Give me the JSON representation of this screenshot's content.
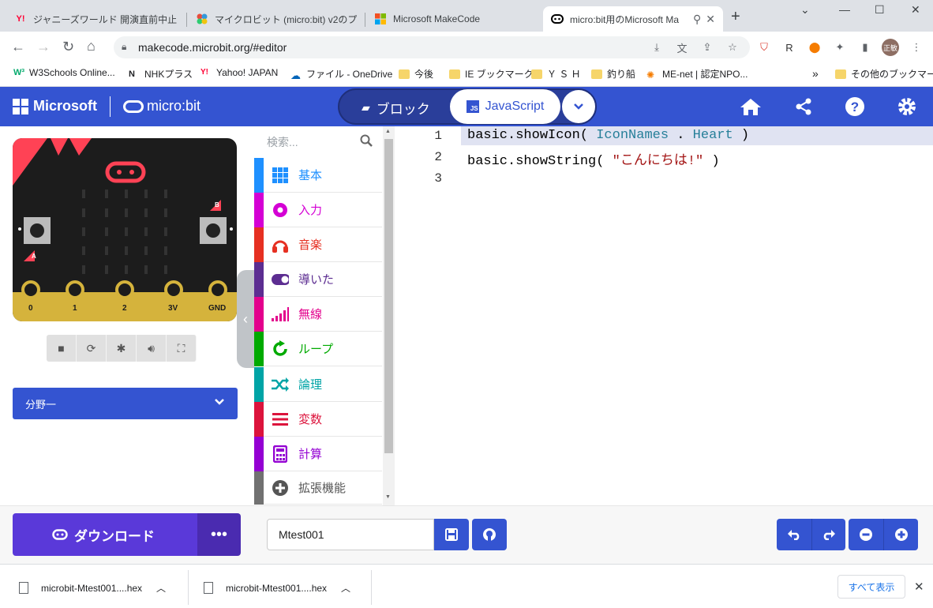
{
  "browser": {
    "tabs": [
      {
        "title": "ジャニーズワールド 開演直前中止 - ",
        "icon": "yahoo-icon"
      },
      {
        "title": "マイクロビット (micro:bit) v2のプロ",
        "icon": "colorful-dots-icon"
      },
      {
        "title": "Microsoft MakeCode",
        "icon": "microsoft-icon"
      },
      {
        "title": "micro:bit用のMicrosoft Ma",
        "icon": "microbit-icon"
      }
    ],
    "url": "makecode.microbit.org/#editor",
    "profile_label": "正敏",
    "bookmarks": [
      {
        "label": "W3Schools Online..."
      },
      {
        "label": "NHKプラス"
      },
      {
        "label": "Yahoo! JAPAN"
      },
      {
        "label": "ファイル - OneDrive"
      },
      {
        "label": "今後"
      },
      {
        "label": "IE ブックマーク"
      },
      {
        "label": "Ｙ Ｓ Ｈ"
      },
      {
        "label": "釣り船"
      },
      {
        "label": "ME-net | 認定NPO..."
      },
      {
        "label": "その他のブックマーク"
      }
    ],
    "more_bookmarks": "»"
  },
  "header": {
    "ms_logo": "Microsoft",
    "microbit_logo": "micro:bit",
    "blocks_label": "ブロック",
    "js_label": "JavaScript",
    "js_badge": "JS"
  },
  "simulator": {
    "pins": [
      "0",
      "1",
      "2",
      "3V",
      "GND"
    ],
    "btn_a": "A",
    "btn_b": "B",
    "category_dropdown": "分野一"
  },
  "toolbox": {
    "search_placeholder": "検索...",
    "categories": [
      {
        "label": "基本",
        "color": "#1e90ff"
      },
      {
        "label": "入力",
        "color": "#d400d4"
      },
      {
        "label": "音楽",
        "color": "#e63022"
      },
      {
        "label": "導いた",
        "color": "#5c2d91"
      },
      {
        "label": "無線",
        "color": "#e3008c"
      },
      {
        "label": "ループ",
        "color": "#00aa00"
      },
      {
        "label": "論理",
        "color": "#00a4a6"
      },
      {
        "label": "変数",
        "color": "#dc143c"
      },
      {
        "label": "計算",
        "color": "#9400d3"
      },
      {
        "label": "拡張機能",
        "color": "#717171"
      }
    ]
  },
  "editor": {
    "line_numbers": [
      "1",
      "2",
      "3"
    ],
    "line1": {
      "a": "basic.showIcon( ",
      "b": "IconNames",
      "c": " . ",
      "d": "Heart",
      "e": " )"
    },
    "line2": {
      "a": "basic.showString( ",
      "b": "\"こんにちは!\"",
      "c": " )"
    }
  },
  "footer": {
    "download_label": "ダウンロード",
    "more_label": "•••",
    "project_name": "Mtest001"
  },
  "downloads": {
    "files": [
      "microbit-Mtest001....hex",
      "microbit-Mtest001....hex"
    ],
    "show_all": "すべて表示"
  }
}
